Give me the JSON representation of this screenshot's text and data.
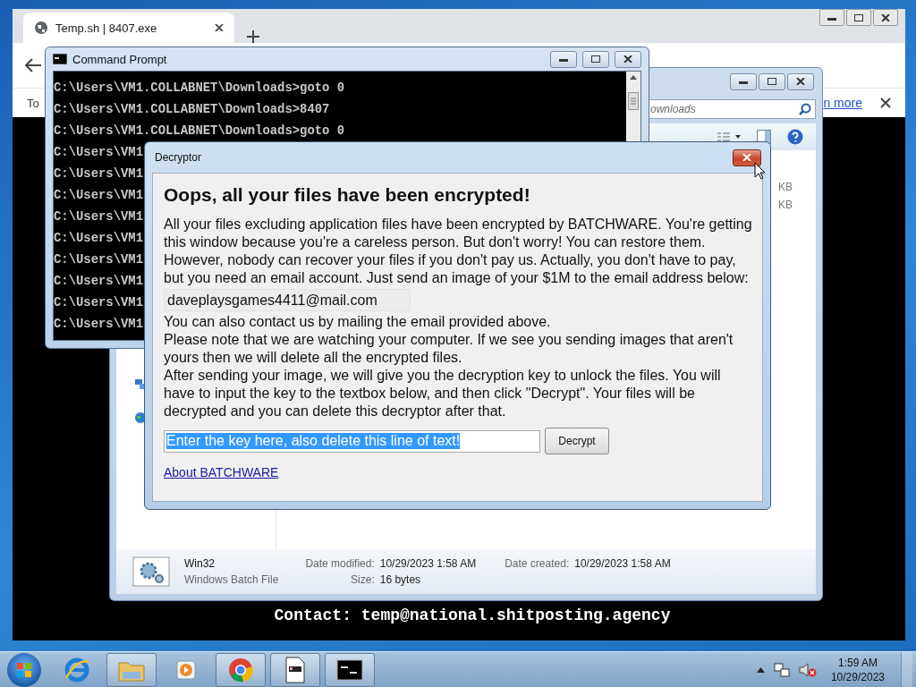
{
  "browser": {
    "tab_title": "Temp.sh | 8407.exe",
    "infobar_text": "To",
    "infobar_link": "n more",
    "page_footer": "Contact: temp@national.shitposting.agency"
  },
  "console": {
    "title": "Command Prompt",
    "lines": [
      "C:\\Users\\VM1.COLLABNET\\Downloads>goto 0",
      "C:\\Users\\VM1.COLLABNET\\Downloads>8407",
      "C:\\Users\\VM1.COLLABNET\\Downloads>goto 0",
      "C:\\Users\\VM1",
      "C:\\Users\\VM1",
      "C:\\Users\\VM1",
      "C:\\Users\\VM1",
      "C:\\Users\\VM1",
      "C:\\Users\\VM1",
      "C:\\Users\\VM1",
      "C:\\Users\\VM1",
      "C:\\Users\\VM1"
    ]
  },
  "explorer": {
    "search_value": "ownloads",
    "sizes": [
      "KB",
      "KB"
    ],
    "details": {
      "name": "Win32",
      "type": "Windows Batch File",
      "fields": [
        {
          "label": "Date modified:",
          "value": "10/29/2023 1:58 AM"
        },
        {
          "label": "Size:",
          "value": "16 bytes"
        },
        {
          "label": "Date created:",
          "value": "10/29/2023 1:58 AM"
        }
      ]
    }
  },
  "dialog": {
    "title": "Decryptor",
    "heading": "Oops, all your files have been encrypted!",
    "paragraph": "All your files excluding application files have been encrypted by BATCHWARE. You're getting this window because you're a careless person. But don't worry! You can restore them. However, nobody can recover your files if you don't pay us. Actually, you don't have to pay, but you need an email account. Just send an image of your $1M to the email address below:",
    "email": "daveplaysgames4411@mail.com",
    "notes": [
      "You can also contact us by mailing the email provided above.",
      "Please note that we are watching your computer. If we see you sending images that aren't yours then we will delete all the encrypted files.",
      "After sending your image, we will give you the decryption key to unlock the files. You will have to input the key to the textbox below, and then click \"Decrypt\". Your files will be\ndecrypted and you can delete this decryptor after that."
    ],
    "key_field": {
      "value": "Enter the key here, also delete this line of text!",
      "selected": true
    },
    "button": "Decrypt",
    "link": "About BATCHWARE"
  },
  "taskbar": {
    "apps": [
      {
        "kind": "browser-e",
        "open": false
      },
      {
        "kind": "folder",
        "open": true
      },
      {
        "kind": "media",
        "open": false
      },
      {
        "kind": "chrome",
        "open": true
      },
      {
        "kind": "document",
        "open": true
      },
      {
        "kind": "console",
        "open": true
      }
    ],
    "time": "1:59 AM",
    "date": "10/29/2023"
  }
}
